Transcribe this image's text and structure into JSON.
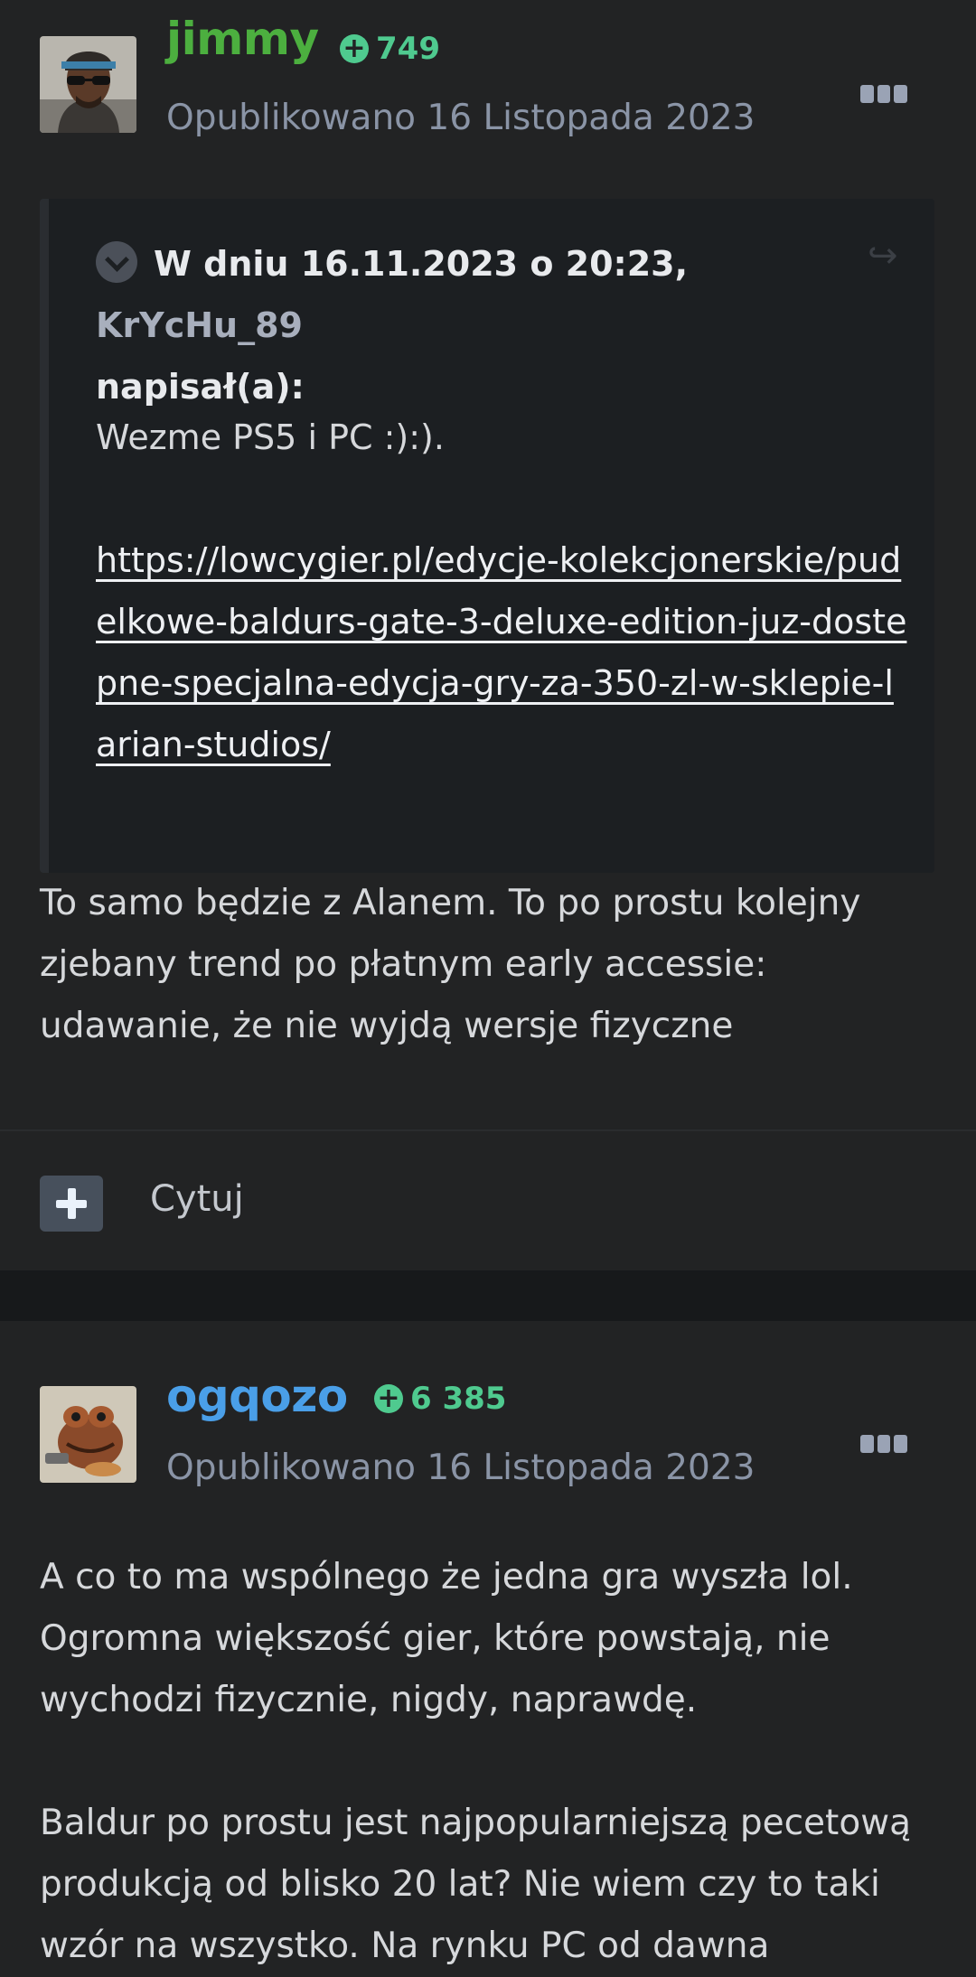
{
  "posts": [
    {
      "username": "jimmy",
      "username_color": "#4caf3f",
      "reputation": "749",
      "posted": "Opublikowano 16 Listopada 2023",
      "quote": {
        "header": "W dniu 16.11.2023 o 20:23,",
        "author": "KrYcHu_89",
        "wrote": "napisał(a):",
        "text": "Wezme PS5 i PC :):).",
        "link": "https://lowcygier.pl/edycje-kolekcjonerskie/pudelkowe-baldurs-gate-3-deluxe-edition-juz-dostepne-specjalna-edycja-gry-za-350-zl-w-sklepie-larian-studios/"
      },
      "body": "To samo będzie z Alanem. To po prostu kolejny zjebany trend po płatnym early accessie: udawanie, że nie wyjdą wersje fizyczne",
      "quote_action_label": "Cytuj"
    },
    {
      "username": "ogqozo",
      "username_color": "#4a9fe8",
      "reputation": "6 385",
      "posted": "Opublikowano 16 Listopada 2023",
      "body_paragraphs": [
        "A co to ma wspólnego że jedna gra wyszła lol. Ogromna większość gier, które powstają, nie wychodzi fizycznie, nigdy, naprawdę.",
        "Baldur po prostu jest najpopularniejszą pecetową produkcją od blisko 20 lat? Nie wiem czy to taki wzór na wszystko. Na rynku PC od dawna"
      ]
    }
  ],
  "icons": {
    "reputation": "plus-circle-icon",
    "more": "ellipsis-icon",
    "collapse": "chevron-down-icon",
    "share": "share-arrow-icon",
    "multiquote": "plus-icon"
  }
}
